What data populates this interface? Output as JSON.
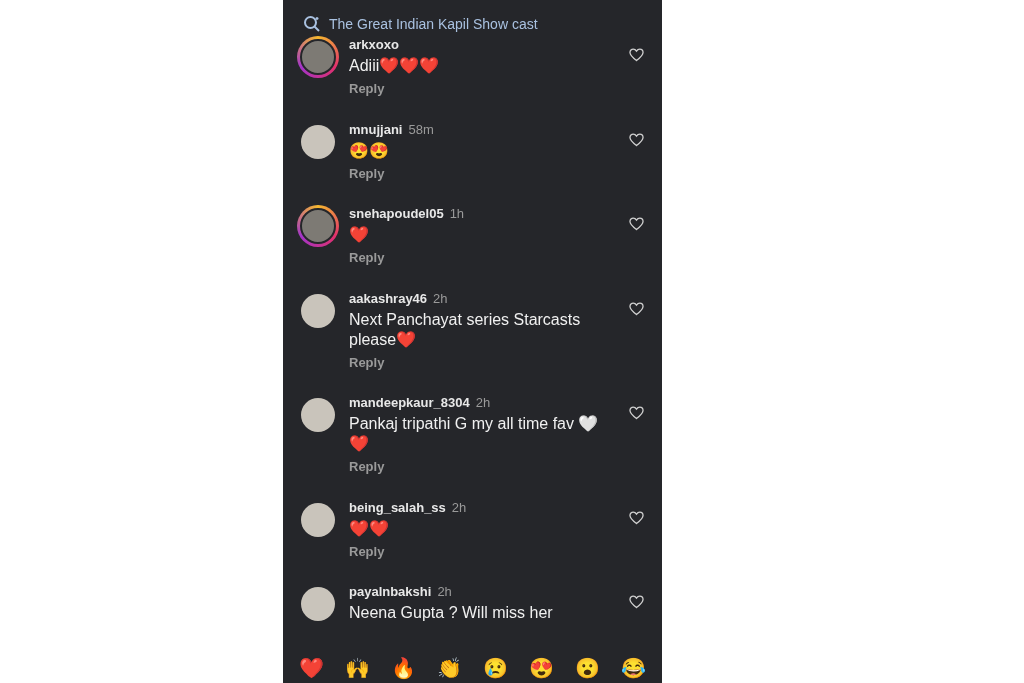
{
  "search": {
    "query": "The Great Indian Kapil Show cast"
  },
  "comments": [
    {
      "username": "arkxoxo",
      "story_ring": true,
      "text": "Adiii❤️❤️❤️",
      "reply": "Reply"
    },
    {
      "username": "mnujjani",
      "time": "58m",
      "story_ring": false,
      "text": "😍😍",
      "reply": "Reply"
    },
    {
      "username": "snehapoudel05",
      "time": "1h",
      "story_ring": true,
      "text": "❤️",
      "reply": "Reply"
    },
    {
      "username": "aakashray46",
      "time": "2h",
      "story_ring": false,
      "text": "Next Panchayat series Starcasts please❤️",
      "reply": "Reply"
    },
    {
      "username": "mandeepkaur_8304",
      "time": "2h",
      "story_ring": false,
      "text": "Pankaj tripathi G  my all time fav 🤍❤️",
      "reply": "Reply"
    },
    {
      "username": "being_salah_ss",
      "time": "2h",
      "story_ring": false,
      "text": "❤️❤️",
      "reply": "Reply"
    },
    {
      "username": "payalnbakshi",
      "time": "2h",
      "story_ring": false,
      "text": "Neena Gupta ? Will miss her"
    }
  ],
  "quick_reactions": [
    "❤️",
    "🙌",
    "🔥",
    "👏",
    "😢",
    "😍",
    "😮",
    "😂"
  ]
}
